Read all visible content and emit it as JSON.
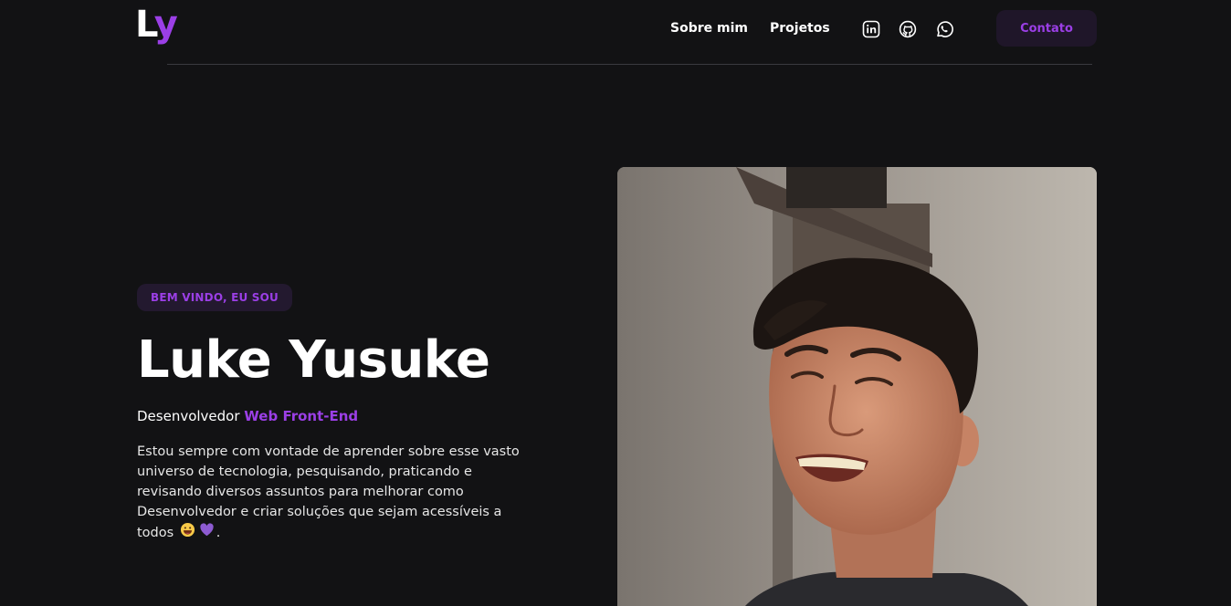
{
  "brand": {
    "logo_l": "L",
    "logo_y": "y",
    "accent_color": "#9b3fe6"
  },
  "nav": {
    "items": [
      {
        "label": "Sobre mim"
      },
      {
        "label": "Projetos"
      }
    ]
  },
  "socials": [
    {
      "icon": "linkedin-icon"
    },
    {
      "icon": "github-icon"
    },
    {
      "icon": "whatsapp-icon"
    }
  ],
  "header": {
    "contact_label": "Contato"
  },
  "hero": {
    "badge": "BEM VINDO, EU SOU",
    "name": "Luke Yusuke",
    "role_prefix": "Desenvolvedor ",
    "role_highlight": "Web Front-End",
    "bio_text": "Estou sempre com vontade de aprender sobre esse vasto universo de tecnologia, pesquisando, praticando e revisando diversos assuntos para melhorar como Desenvolvedor e criar soluções que sejam acessíveis a todos",
    "bio_end": ".",
    "emojis": [
      "grinning-emoji",
      "purple-heart-emoji"
    ]
  },
  "colors": {
    "background": "#121214",
    "badge_bg": "#23192f",
    "button_bg": "#1f1629"
  }
}
